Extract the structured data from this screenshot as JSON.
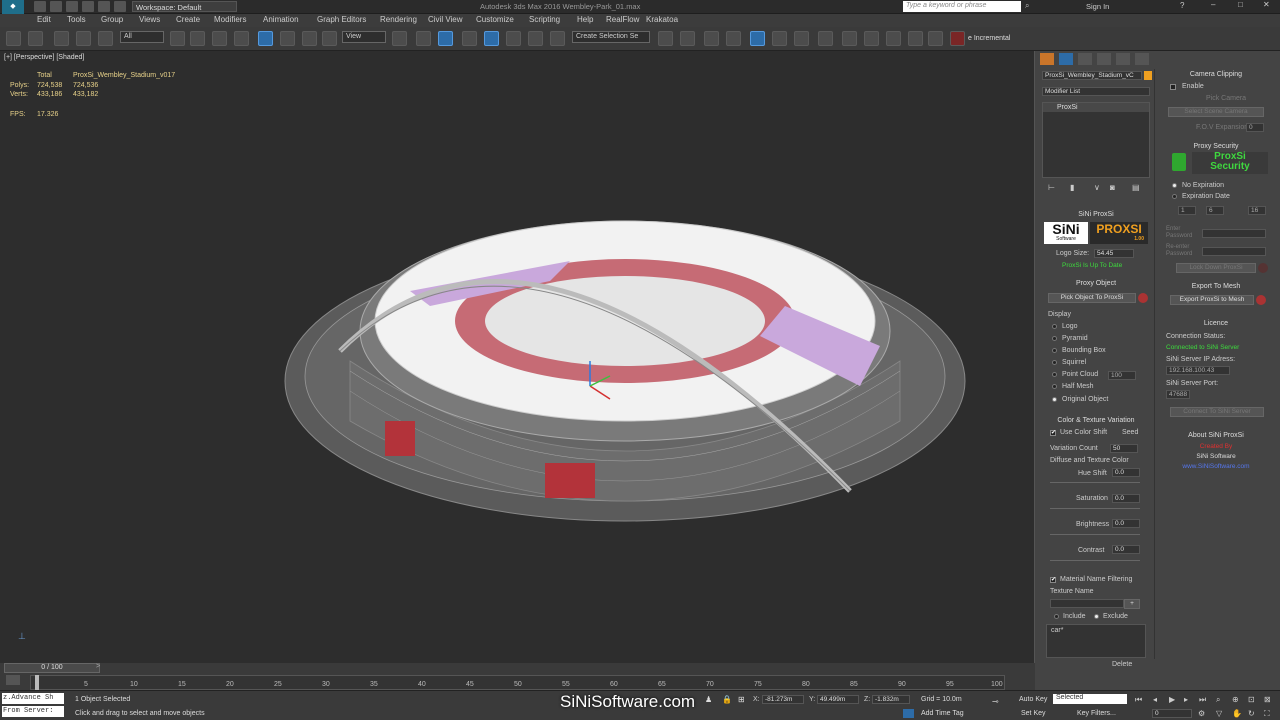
{
  "titlebar": {
    "workspace": "Workspace: Default",
    "app_title": "Autodesk 3ds Max 2016    Wembley-Park_01.max",
    "search_placeholder": "Type a keyword or phrase",
    "sign_in": "Sign In"
  },
  "menu": [
    "Edit",
    "Tools",
    "Group",
    "Views",
    "Create",
    "Modifiers",
    "Animation",
    "Graph Editors",
    "Rendering",
    "Civil View",
    "Customize",
    "Scripting",
    "Help",
    "RealFlow",
    "Krakatoa"
  ],
  "toolbar": {
    "filter_value": "All",
    "ref_coord_value": "View",
    "selection_set_placeholder": "Create Selection Se",
    "incremental_label": "e Incremental"
  },
  "viewport": {
    "label": "[+] [Perspective] [Shaded]",
    "stats_total_label": "Total",
    "stats_object": "ProxSi_Wembley_Stadium_v017",
    "polys_label": "Polys:",
    "polys_total": "724,538",
    "polys_obj": "724,536",
    "verts_label": "Verts:",
    "verts_total": "433,186",
    "verts_obj": "433,182",
    "fps_label": "FPS:",
    "fps_value": "17.326"
  },
  "modify_panel": {
    "object_name": "ProxSi_Wembley_Stadium_vC",
    "modifier_list": "Modifier List",
    "stack_item": "ProxSi",
    "sini_title": "SiNi ProxSi",
    "sini_logo": "SiNi",
    "sini_logo_sub": "Software",
    "proxsi_logo": "PROXSI",
    "proxsi_version": "1.00",
    "logo_size_label": "Logo Size:",
    "logo_size_value": "54.45",
    "up_to_date": "ProxSi Is Up To Date",
    "proxy_object_title": "Proxy Object",
    "pick_object_btn": "Pick Object To ProxSi",
    "display_label": "Display",
    "display_options": [
      "Logo",
      "Pyramid",
      "Bounding Box",
      "Squirrel",
      "Point Cloud",
      "Half Mesh",
      "Original Object"
    ],
    "display_selected": 6,
    "point_cloud_value": "100",
    "color_variation_title": "Color & Texture Variation",
    "use_color_shift": "Use Color Shift",
    "seed_btn": "Seed",
    "variation_count_label": "Variation Count",
    "variation_count_value": "50",
    "diffuse_label": "Diffuse and Texture Color",
    "hue_shift_label": "Hue Shift",
    "hue_shift_value": "0.0",
    "saturation_label": "Saturation",
    "saturation_value": "0.0",
    "brightness_label": "Brightness",
    "brightness_value": "0.0",
    "contrast_label": "Contrast",
    "contrast_value": "0.0",
    "material_filter": "Material Name Filtering",
    "texture_name_label": "Texture Name",
    "add_btn": "+",
    "include_label": "Include",
    "exclude_label": "Exclude",
    "filter_item": "car*",
    "delete_btn": "Delete"
  },
  "side_panel": {
    "camera_clipping_title": "Camera Clipping",
    "enable_label": "Enable",
    "pick_camera": "Pick Camera",
    "select_scene_camera": "Select Scene Camera",
    "fov_label": "F.O.V Expansion",
    "fov_value": "0",
    "proxy_security_title": "Proxy Security",
    "security_logo_1": "ProxSi",
    "security_logo_2": "Security",
    "no_expiration": "No Expiration",
    "expiration_date": "Expiration Date",
    "date_1": "1",
    "date_2": "6",
    "date_3": "16",
    "enter_password": "Enter Password",
    "reenter_password": "Re-enter Password",
    "lock_down_btn": "Lock Down ProxSi",
    "export_title": "Export To Mesh",
    "export_btn": "Export ProxSi to Mesh",
    "licence_title": "Licence",
    "connection_status_label": "Connection Status:",
    "connection_status_value": "Connected to SiNi Server",
    "server_ip_label": "SiNi Server IP Adress:",
    "server_ip_value": "192.168.100.43",
    "server_port_label": "SiNi Server Port:",
    "server_port_value": "47688",
    "connect_btn": "Connect To SiNi Server",
    "about_title": "About SiNi ProxSi",
    "created_by": "Created By",
    "company": "SiNi Software",
    "website": "www.SiNiSoftware.com"
  },
  "timeline": {
    "frame_counter": "0 / 100",
    "ticks": [
      "0",
      "5",
      "10",
      "15",
      "20",
      "25",
      "30",
      "35",
      "40",
      "45",
      "50",
      "55",
      "60",
      "65",
      "70",
      "75",
      "80",
      "85",
      "90",
      "95",
      "100"
    ]
  },
  "status": {
    "maxscript_1": "z.Advance Sh",
    "maxscript_2": "From Server:",
    "selected_text": "1 Object Selected",
    "prompt_text": "Click and drag to select and move objects",
    "watermark": "SiNiSoftware.com",
    "x_label": "X:",
    "x_value": "-81.273m",
    "y_label": "Y:",
    "y_value": "49.499m",
    "z_label": "Z:",
    "z_value": "-1.832m",
    "grid_label": "Grid = 10.0m",
    "add_time_tag": "Add Time Tag",
    "auto_key": "Auto Key",
    "set_key": "Set Key",
    "selected_dd": "Selected",
    "key_filters": "Key Filters...",
    "frame_value": "0"
  }
}
